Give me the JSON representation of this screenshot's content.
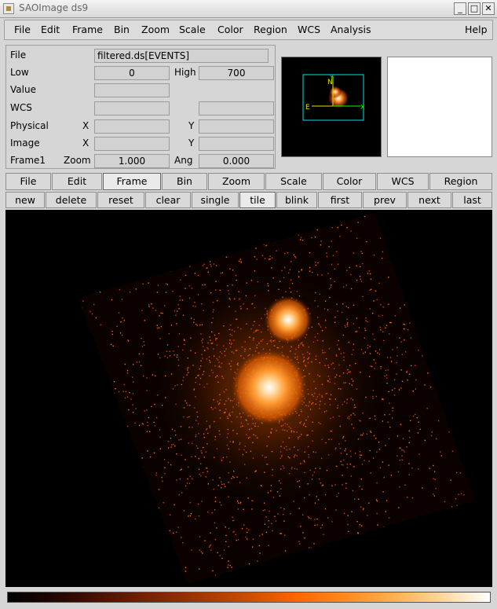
{
  "window": {
    "title": "SAOImage ds9",
    "minimize": "_",
    "maximize": "□",
    "close": "✕"
  },
  "menubar": {
    "items": [
      "File",
      "Edit",
      "Frame",
      "Bin",
      "Zoom",
      "Scale",
      "Color",
      "Region",
      "WCS",
      "Analysis"
    ],
    "help": "Help"
  },
  "info": {
    "file_label": "File",
    "file_value": "filtered.ds[EVENTS]",
    "low_label": "Low",
    "low_value": "0",
    "high_label": "High",
    "high_value": "700",
    "value_label": "Value",
    "wcs_label": "WCS",
    "physical_label": "Physical",
    "image_label": "Image",
    "x_label": "X",
    "y_label": "Y",
    "frame_label": "Frame1",
    "zoom_label": "Zoom",
    "zoom_value": "1.000",
    "ang_label": "Ang",
    "ang_value": "0.000"
  },
  "panner": {
    "north": "N",
    "east": "E",
    "y_axis": "Y",
    "x_axis": "X"
  },
  "buttonbar": {
    "main": [
      "File",
      "Edit",
      "Frame",
      "Bin",
      "Zoom",
      "Scale",
      "Color",
      "WCS",
      "Region"
    ],
    "main_active": "Frame",
    "sub": [
      "new",
      "delete",
      "reset",
      "clear",
      "single",
      "tile",
      "blink",
      "first",
      "prev",
      "next",
      "last"
    ],
    "sub_active": "tile"
  },
  "colors": {
    "colormap": "heat",
    "panner_box": "#00e0e0",
    "compass": "#e0e000",
    "axes": "#00ff00"
  }
}
